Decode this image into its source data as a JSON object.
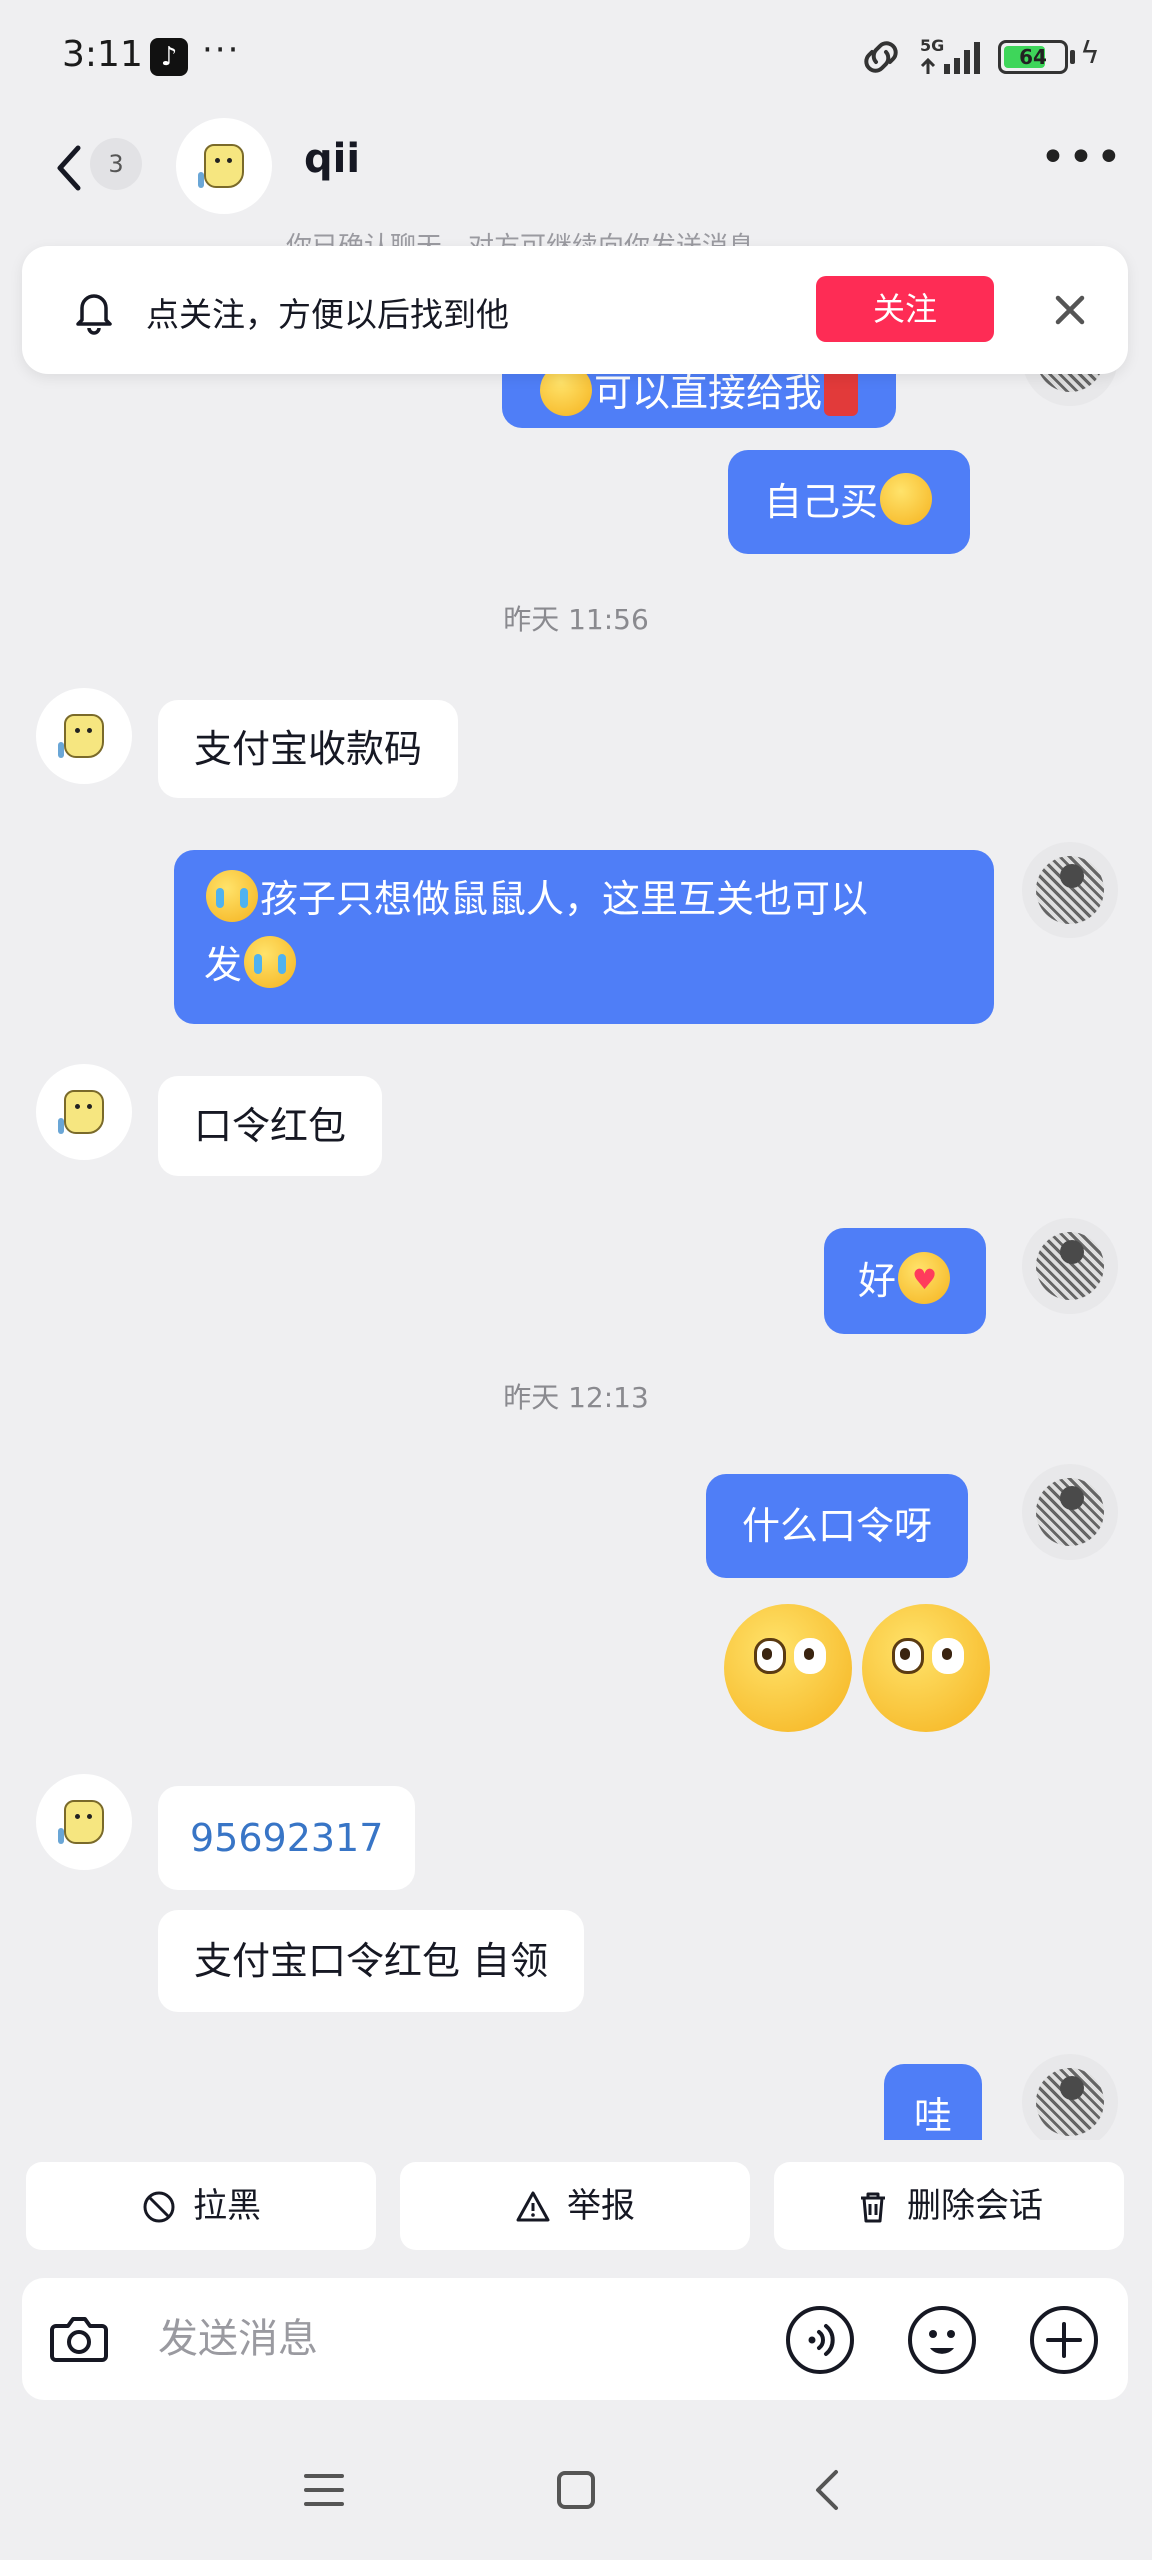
{
  "status_bar": {
    "time": "3:11",
    "tiktok_icon": "tiktok-icon",
    "more": "···",
    "network": "5G",
    "battery": "64",
    "battery_level": 0.64
  },
  "header": {
    "unread_count": "3",
    "name": "qii"
  },
  "hidden_notice": "你已确认聊天，对方可继续向你发送消息",
  "follow_banner": {
    "text": "点关注，方便以后找到他",
    "button": "关注"
  },
  "messages": [
    {
      "from": "me",
      "text": "可以直接给我",
      "partial": true
    },
    {
      "from": "me",
      "text": "自己买"
    },
    {
      "type": "time",
      "text": "昨天 11:56"
    },
    {
      "from": "other",
      "text": "支付宝收款码"
    },
    {
      "from": "me",
      "text_line1": "孩子只想做鼠鼠人，这里互关也可以",
      "text_line2": "发"
    },
    {
      "from": "other",
      "text": "口令红包"
    },
    {
      "from": "me",
      "text": "好"
    },
    {
      "type": "time",
      "text": "昨天 12:13"
    },
    {
      "from": "me",
      "text": "什么口令呀"
    },
    {
      "from": "other",
      "text": "95692317"
    },
    {
      "from": "other",
      "text": "支付宝口令红包 自领"
    },
    {
      "from": "me",
      "text": "哇",
      "partial": true
    }
  ],
  "actions": {
    "block": "拉黑",
    "report": "举报",
    "delete": "删除会话"
  },
  "input": {
    "placeholder": "发送消息"
  },
  "colors": {
    "my_bubble": "#4f7ef7",
    "follow_button": "#fe2c55",
    "link": "#3875c6"
  }
}
